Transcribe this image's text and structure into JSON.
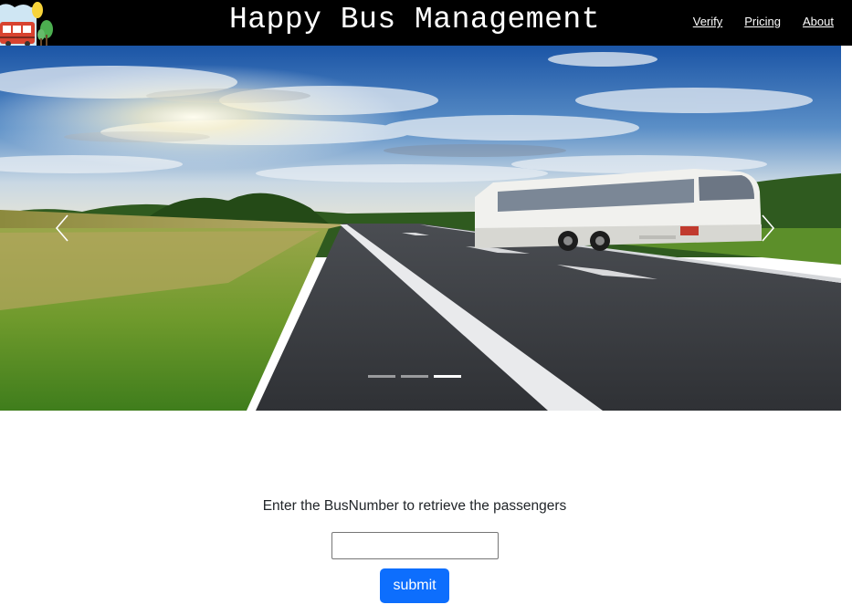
{
  "header": {
    "title": "Happy Bus Management",
    "nav": [
      {
        "label": "Verify"
      },
      {
        "label": "Pricing"
      },
      {
        "label": "About"
      }
    ]
  },
  "carousel": {
    "slide_count": 3,
    "active_index": 2,
    "icons": {
      "prev": "chevron-left-icon",
      "next": "chevron-right-icon"
    }
  },
  "form": {
    "prompt": "Enter the BusNumber to retrieve the passengers",
    "input_value": "",
    "input_placeholder": "",
    "submit_label": "submit"
  },
  "colors": {
    "navbar": "#000000",
    "primary_button": "#0d6efd"
  }
}
